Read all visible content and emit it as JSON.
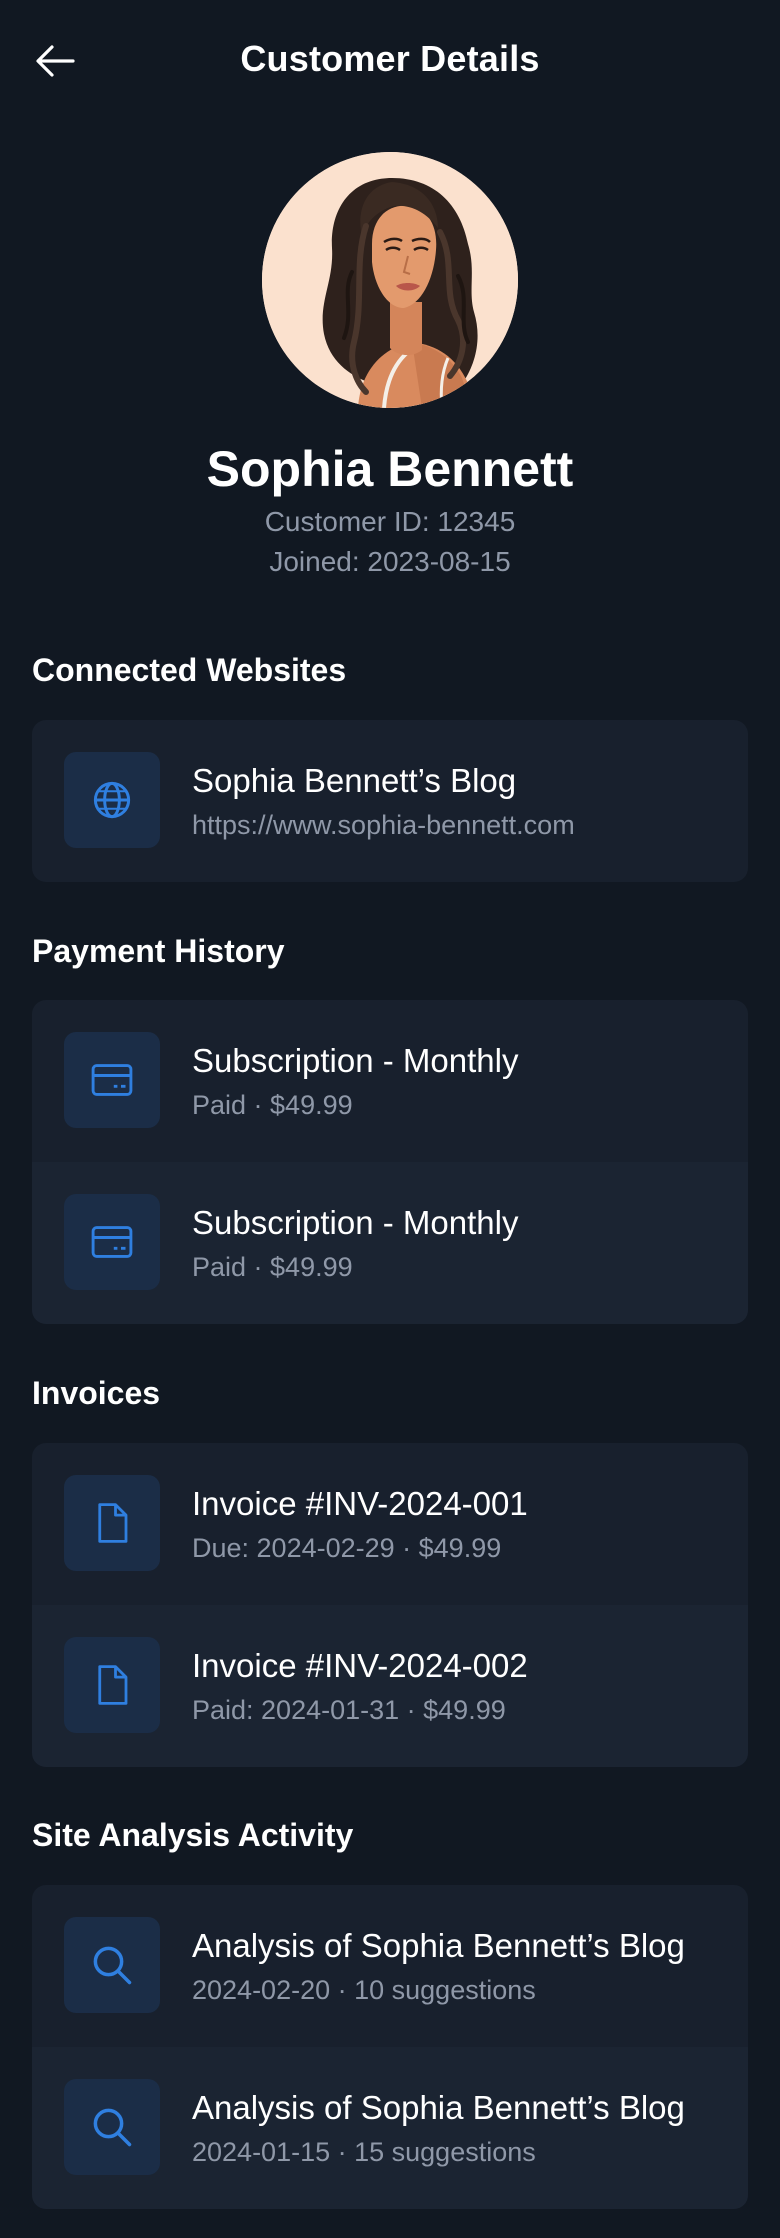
{
  "header": {
    "title": "Customer Details",
    "back_icon": "arrow-left-icon"
  },
  "profile": {
    "name": "Sophia Bennett",
    "customer_id": "Customer ID: 12345",
    "joined": "Joined: 2023-08-15"
  },
  "colors": {
    "background": "#111822",
    "card": "#18202d",
    "card_alt": "#1b2432",
    "icon_box": "#1b2d47",
    "accent": "#2f7fe0",
    "muted_text": "#8f98a8",
    "avatar_bg": "#fbe1ce"
  },
  "connected_websites": {
    "title": "Connected Websites",
    "items": [
      {
        "icon": "globe-icon",
        "title": "Sophia Bennett’s Blog",
        "subtitle": "https://www.sophia-bennett.com"
      }
    ]
  },
  "payment_history": {
    "title": "Payment History",
    "items": [
      {
        "icon": "credit-card-icon",
        "title": "Subscription - Monthly",
        "subtitle": "Paid · $49.99"
      },
      {
        "icon": "credit-card-icon",
        "title": "Subscription - Monthly",
        "subtitle": "Paid · $49.99"
      }
    ]
  },
  "invoices": {
    "title": "Invoices",
    "items": [
      {
        "icon": "document-icon",
        "title": "Invoice #INV-2024-001",
        "subtitle": "Due: 2024-02-29 · $49.99"
      },
      {
        "icon": "document-icon",
        "title": "Invoice #INV-2024-002",
        "subtitle": "Paid: 2024-01-31 · $49.99"
      }
    ]
  },
  "site_analysis": {
    "title": "Site Analysis Activity",
    "items": [
      {
        "icon": "search-icon",
        "title": "Analysis of Sophia Bennett’s Blog",
        "subtitle": "2024-02-20 · 10 suggestions"
      },
      {
        "icon": "search-icon",
        "title": "Analysis of Sophia Bennett’s Blog",
        "subtitle": "2024-01-15 · 15 suggestions"
      }
    ]
  }
}
